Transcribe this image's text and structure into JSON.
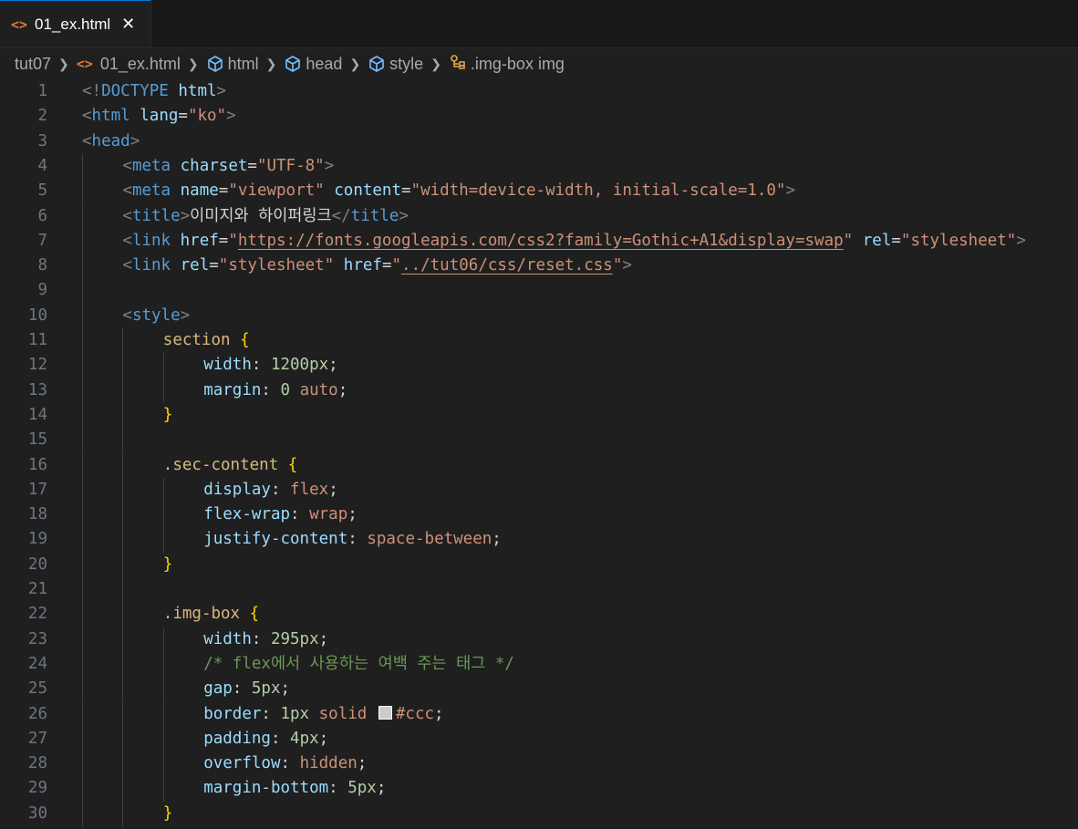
{
  "tab": {
    "label": "01_ex.html",
    "icon": "html-file-icon",
    "close": "✕"
  },
  "breadcrumb": [
    {
      "label": "tut07",
      "icon": ""
    },
    {
      "label": "01_ex.html",
      "icon": "html-file-icon"
    },
    {
      "label": "html",
      "icon": "cube-icon"
    },
    {
      "label": "head",
      "icon": "cube-icon"
    },
    {
      "label": "style",
      "icon": "cube-icon"
    },
    {
      "label": ".img-box img",
      "icon": "css-selector-icon"
    }
  ],
  "colors": {
    "tag": "#569cd6",
    "attr": "#9cdcfe",
    "string": "#ce9178",
    "selector": "#d7ba7d",
    "brace": "#ffd700",
    "number": "#b5cea8",
    "comment": "#6a9955"
  },
  "editor": {
    "lines": [
      {
        "n": "1",
        "indent": 0,
        "tokens": [
          [
            "punct",
            "<!"
          ],
          [
            "tag",
            "DOCTYPE"
          ],
          [
            "text",
            " "
          ],
          [
            "attr",
            "html"
          ],
          [
            "punct",
            ">"
          ]
        ]
      },
      {
        "n": "2",
        "indent": 0,
        "tokens": [
          [
            "punct",
            "<"
          ],
          [
            "tag",
            "html"
          ],
          [
            "text",
            " "
          ],
          [
            "attr",
            "lang"
          ],
          [
            "text",
            "="
          ],
          [
            "str",
            "\"ko\""
          ],
          [
            "punct",
            ">"
          ]
        ]
      },
      {
        "n": "3",
        "indent": 0,
        "tokens": [
          [
            "punct",
            "<"
          ],
          [
            "tag",
            "head"
          ],
          [
            "punct",
            ">"
          ]
        ]
      },
      {
        "n": "4",
        "indent": 1,
        "tokens": [
          [
            "punct",
            "<"
          ],
          [
            "tag",
            "meta"
          ],
          [
            "text",
            " "
          ],
          [
            "attr",
            "charset"
          ],
          [
            "text",
            "="
          ],
          [
            "str",
            "\"UTF-8\""
          ],
          [
            "punct",
            ">"
          ]
        ]
      },
      {
        "n": "5",
        "indent": 1,
        "tokens": [
          [
            "punct",
            "<"
          ],
          [
            "tag",
            "meta"
          ],
          [
            "text",
            " "
          ],
          [
            "attr",
            "name"
          ],
          [
            "text",
            "="
          ],
          [
            "str",
            "\"viewport\""
          ],
          [
            "text",
            " "
          ],
          [
            "attr",
            "content"
          ],
          [
            "text",
            "="
          ],
          [
            "str",
            "\"width=device-width, initial-scale=1.0\""
          ],
          [
            "punct",
            ">"
          ]
        ]
      },
      {
        "n": "6",
        "indent": 1,
        "tokens": [
          [
            "punct",
            "<"
          ],
          [
            "tag",
            "title"
          ],
          [
            "punct",
            ">"
          ],
          [
            "text",
            "이미지와 하이퍼링크"
          ],
          [
            "punct",
            "</"
          ],
          [
            "tag",
            "title"
          ],
          [
            "punct",
            ">"
          ]
        ]
      },
      {
        "n": "7",
        "indent": 1,
        "tokens": [
          [
            "punct",
            "<"
          ],
          [
            "tag",
            "link"
          ],
          [
            "text",
            " "
          ],
          [
            "attr",
            "href"
          ],
          [
            "text",
            "="
          ],
          [
            "str",
            "\""
          ],
          [
            "url",
            "https://fonts.googleapis.com/css2?family=Gothic+A1&display=swap"
          ],
          [
            "str",
            "\""
          ],
          [
            "text",
            " "
          ],
          [
            "attr",
            "rel"
          ],
          [
            "text",
            "="
          ],
          [
            "str",
            "\"stylesheet\""
          ],
          [
            "punct",
            ">"
          ]
        ]
      },
      {
        "n": "8",
        "indent": 1,
        "tokens": [
          [
            "punct",
            "<"
          ],
          [
            "tag",
            "link"
          ],
          [
            "text",
            " "
          ],
          [
            "attr",
            "rel"
          ],
          [
            "text",
            "="
          ],
          [
            "str",
            "\"stylesheet\""
          ],
          [
            "text",
            " "
          ],
          [
            "attr",
            "href"
          ],
          [
            "text",
            "="
          ],
          [
            "str",
            "\""
          ],
          [
            "url",
            "../tut06/css/reset.css"
          ],
          [
            "str",
            "\""
          ],
          [
            "punct",
            ">"
          ]
        ]
      },
      {
        "n": "9",
        "indent": 1,
        "tokens": []
      },
      {
        "n": "10",
        "indent": 1,
        "tokens": [
          [
            "punct",
            "<"
          ],
          [
            "tag",
            "style"
          ],
          [
            "punct",
            ">"
          ]
        ]
      },
      {
        "n": "11",
        "indent": 2,
        "tokens": [
          [
            "sel",
            "section"
          ],
          [
            "text",
            " "
          ],
          [
            "brace",
            "{"
          ]
        ]
      },
      {
        "n": "12",
        "indent": 3,
        "tokens": [
          [
            "prop",
            "width"
          ],
          [
            "text",
            ": "
          ],
          [
            "num",
            "1200px"
          ],
          [
            "text",
            ";"
          ]
        ]
      },
      {
        "n": "13",
        "indent": 3,
        "tokens": [
          [
            "prop",
            "margin"
          ],
          [
            "text",
            ": "
          ],
          [
            "num",
            "0"
          ],
          [
            "text",
            " "
          ],
          [
            "val",
            "auto"
          ],
          [
            "text",
            ";"
          ]
        ]
      },
      {
        "n": "14",
        "indent": 2,
        "tokens": [
          [
            "brace",
            "}"
          ]
        ]
      },
      {
        "n": "15",
        "indent": 2,
        "tokens": []
      },
      {
        "n": "16",
        "indent": 2,
        "tokens": [
          [
            "sel",
            ".sec-content"
          ],
          [
            "text",
            " "
          ],
          [
            "brace",
            "{"
          ]
        ]
      },
      {
        "n": "17",
        "indent": 3,
        "tokens": [
          [
            "prop",
            "display"
          ],
          [
            "text",
            ": "
          ],
          [
            "val",
            "flex"
          ],
          [
            "text",
            ";"
          ]
        ]
      },
      {
        "n": "18",
        "indent": 3,
        "tokens": [
          [
            "prop",
            "flex-wrap"
          ],
          [
            "text",
            ": "
          ],
          [
            "val",
            "wrap"
          ],
          [
            "text",
            ";"
          ]
        ]
      },
      {
        "n": "19",
        "indent": 3,
        "tokens": [
          [
            "prop",
            "justify-content"
          ],
          [
            "text",
            ": "
          ],
          [
            "val",
            "space-between"
          ],
          [
            "text",
            ";"
          ]
        ]
      },
      {
        "n": "20",
        "indent": 2,
        "tokens": [
          [
            "brace",
            "}"
          ]
        ]
      },
      {
        "n": "21",
        "indent": 2,
        "tokens": []
      },
      {
        "n": "22",
        "indent": 2,
        "tokens": [
          [
            "sel",
            ".img-box"
          ],
          [
            "text",
            " "
          ],
          [
            "brace",
            "{"
          ]
        ]
      },
      {
        "n": "23",
        "indent": 3,
        "tokens": [
          [
            "prop",
            "width"
          ],
          [
            "text",
            ": "
          ],
          [
            "num",
            "295px"
          ],
          [
            "text",
            ";"
          ]
        ]
      },
      {
        "n": "24",
        "indent": 3,
        "tokens": [
          [
            "cmt",
            "/* flex에서 사용하는 여백 주는 태그 */"
          ]
        ]
      },
      {
        "n": "25",
        "indent": 3,
        "tokens": [
          [
            "prop",
            "gap"
          ],
          [
            "text",
            ": "
          ],
          [
            "num",
            "5px"
          ],
          [
            "text",
            ";"
          ]
        ]
      },
      {
        "n": "26",
        "indent": 3,
        "tokens": [
          [
            "prop",
            "border"
          ],
          [
            "text",
            ": "
          ],
          [
            "num",
            "1px"
          ],
          [
            "text",
            " "
          ],
          [
            "val",
            "solid"
          ],
          [
            "text",
            " "
          ],
          [
            "swatch",
            ""
          ],
          [
            "val",
            "#ccc"
          ],
          [
            "text",
            ";"
          ]
        ]
      },
      {
        "n": "27",
        "indent": 3,
        "tokens": [
          [
            "prop",
            "padding"
          ],
          [
            "text",
            ": "
          ],
          [
            "num",
            "4px"
          ],
          [
            "text",
            ";"
          ]
        ]
      },
      {
        "n": "28",
        "indent": 3,
        "tokens": [
          [
            "prop",
            "overflow"
          ],
          [
            "text",
            ": "
          ],
          [
            "val",
            "hidden"
          ],
          [
            "text",
            ";"
          ]
        ]
      },
      {
        "n": "29",
        "indent": 3,
        "tokens": [
          [
            "prop",
            "margin-bottom"
          ],
          [
            "text",
            ": "
          ],
          [
            "num",
            "5px"
          ],
          [
            "text",
            ";"
          ]
        ]
      },
      {
        "n": "30",
        "indent": 2,
        "tokens": [
          [
            "brace",
            "}"
          ]
        ]
      }
    ]
  }
}
